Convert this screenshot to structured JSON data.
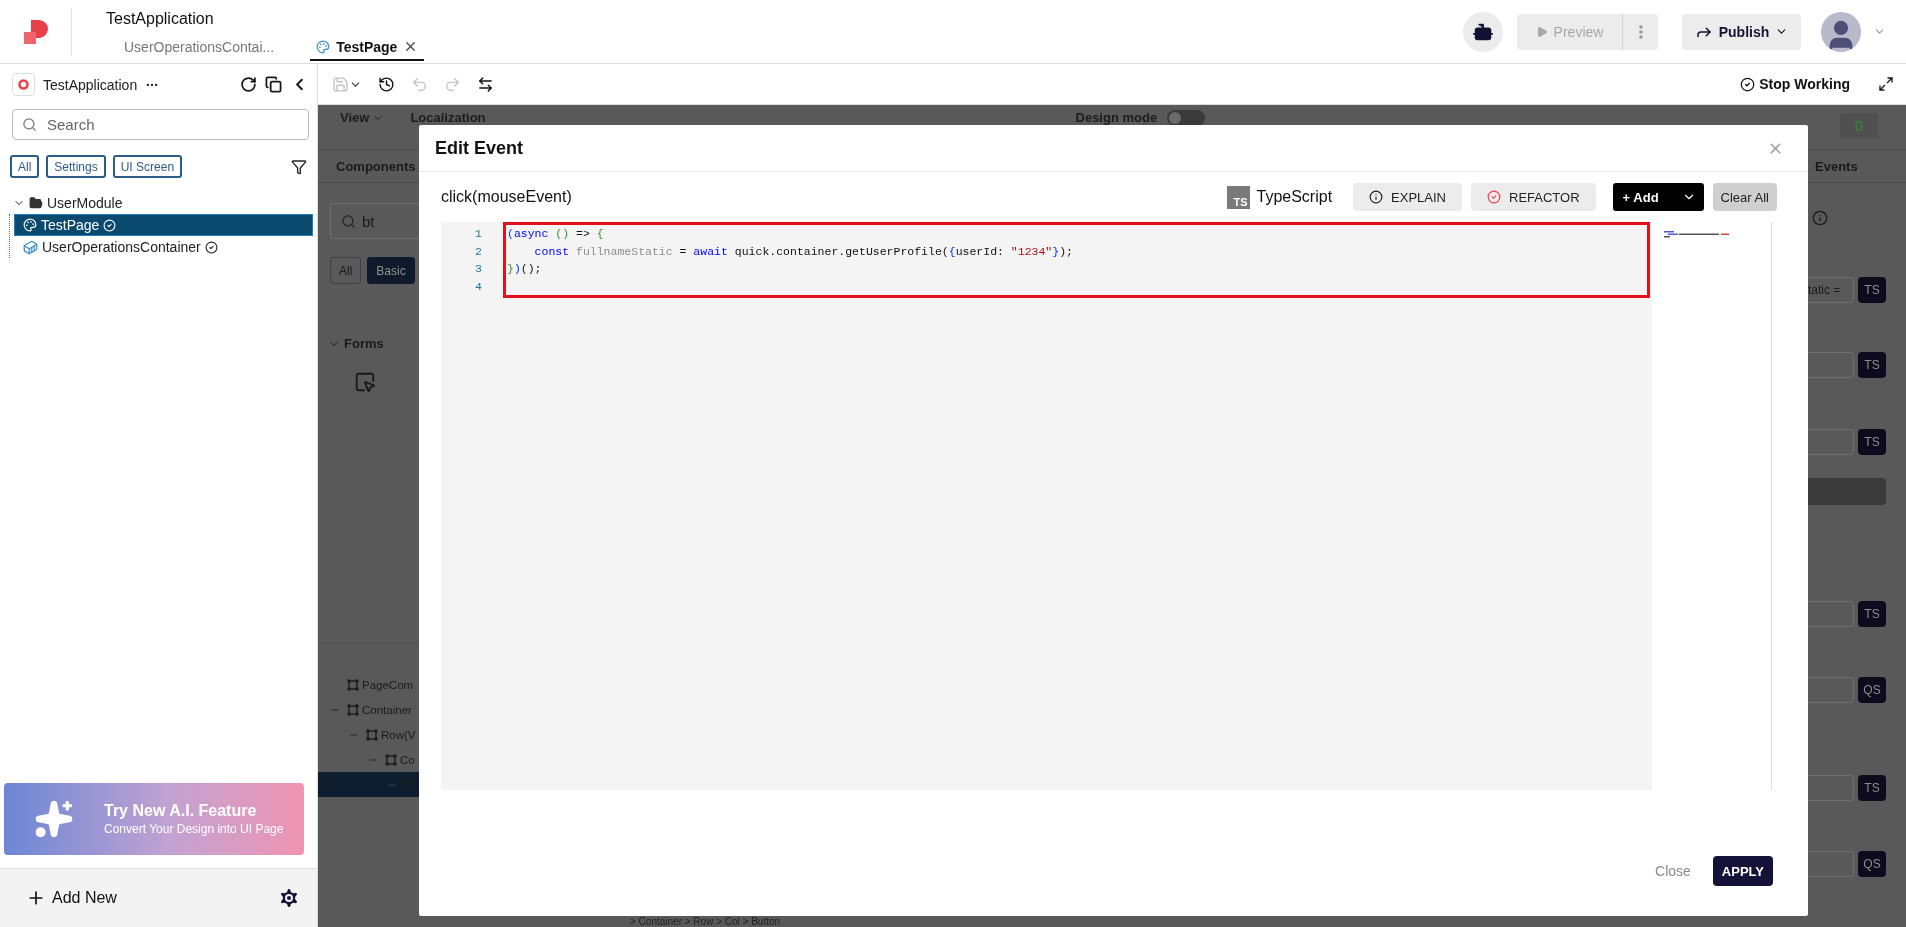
{
  "topbar": {
    "title": "TestApplication",
    "tabs": [
      {
        "label": "UserOperationsContai...",
        "selected": false
      },
      {
        "label": "TestPage",
        "selected": true
      }
    ],
    "preview": {
      "label": "Preview",
      "disabled": true
    },
    "publish": {
      "label": "Publish"
    }
  },
  "sidebar": {
    "app_name": "TestApplication",
    "search": {
      "placeholder": "Search"
    },
    "filters": [
      {
        "label": "All"
      },
      {
        "label": "Settings"
      },
      {
        "label": "UI Screen"
      }
    ],
    "tree": [
      {
        "label": "UserModule",
        "kind": "module",
        "selected": false,
        "expanded": true,
        "children": [
          {
            "label": "TestPage",
            "kind": "page",
            "selected": true
          },
          {
            "label": "UserOperationsContainer",
            "kind": "container",
            "selected": false
          }
        ]
      }
    ],
    "promo": {
      "title": "Try New A.I. Feature",
      "subtitle": "Convert Your Design into UI Page"
    },
    "add_new": "Add New"
  },
  "toolbar": {
    "tools": [
      {
        "kind": "save",
        "disabled": true
      },
      {
        "kind": "history",
        "disabled": false
      },
      {
        "kind": "undo",
        "disabled": true
      },
      {
        "kind": "redo",
        "disabled": true
      },
      {
        "kind": "swap",
        "disabled": false
      }
    ],
    "stop_working": "Stop Working"
  },
  "workspace": {
    "menu": "View",
    "localization": "Localization",
    "design_mode": {
      "label": "Design mode",
      "on": false
    },
    "counter": "0",
    "left_panel": {
      "tab": "Components",
      "search_value": "bt",
      "chips": [
        {
          "label": "All",
          "selected": false
        },
        {
          "label": "Basic",
          "selected": true
        }
      ],
      "section": "Forms",
      "tree": [
        {
          "label": "PageCom",
          "selected": false,
          "expanded": false
        },
        {
          "label": "Container",
          "selected": false,
          "expanded": true,
          "children": [
            {
              "label": "Row(V",
              "selected": false,
              "expanded": true,
              "children": [
                {
                  "label": "Co",
                  "selected": false,
                  "expanded": true,
                  "children": [
                    {
                      "selected": true,
                      "expanded": true
                    }
                  ]
                }
              ]
            }
          ]
        }
      ]
    },
    "right_panel": {
      "tab": "Events",
      "rows": [
        {
          "kind": "field",
          "value": "tatic =",
          "badge": "TS"
        },
        {
          "kind": "field",
          "badge": "TS"
        },
        {
          "kind": "field",
          "badge": "TS"
        },
        {
          "kind": "action"
        },
        {
          "kind": "field",
          "badge": "TS"
        },
        {
          "kind": "field",
          "badge": "QS"
        },
        {
          "kind": "field",
          "badge": "TS"
        },
        {
          "kind": "field",
          "badge": "QS"
        }
      ]
    },
    "breadcrumb": "> Container > Row > Col > Button"
  },
  "modal": {
    "title": "Edit Event",
    "event": "click(mouseEvent)",
    "language_badge": "TS",
    "language": "TypeScript",
    "actions": [
      {
        "kind": "explain",
        "label": "EXPLAIN"
      },
      {
        "kind": "refactor",
        "label": "REFACTOR"
      },
      {
        "kind": "add",
        "label": "+ Add"
      },
      {
        "kind": "clear",
        "label": "Clear All"
      }
    ],
    "code": [
      {
        "number": "1",
        "tokens": [
          {
            "text": "(",
            "kind": "bracket1"
          },
          {
            "text": "async ",
            "kind": "keyword"
          },
          {
            "text": "()",
            "kind": "bracket2"
          },
          {
            "text": " => ",
            "kind": "plain"
          },
          {
            "text": "{",
            "kind": "bracket2"
          }
        ]
      },
      {
        "number": "2",
        "tokens": [
          {
            "text": "    const ",
            "kind": "keyword"
          },
          {
            "text": "fullnameStatic",
            "kind": "variable"
          },
          {
            "text": " = ",
            "kind": "plain"
          },
          {
            "text": "await ",
            "kind": "keyword"
          },
          {
            "text": "quick.container.getUserProfile(",
            "kind": "plain"
          },
          {
            "text": "{",
            "kind": "bracket1"
          },
          {
            "text": "userId: ",
            "kind": "plain"
          },
          {
            "text": "\"1234\"",
            "kind": "string"
          },
          {
            "text": "}",
            "kind": "bracket1"
          },
          {
            "text": ");",
            "kind": "plain"
          }
        ]
      },
      {
        "number": "3",
        "tokens": [
          {
            "text": "}",
            "kind": "bracket2"
          },
          {
            "text": ")",
            "kind": "bracket1"
          },
          {
            "text": "();",
            "kind": "plain"
          }
        ]
      },
      {
        "number": "4"
      }
    ],
    "footer": {
      "close": "Close",
      "apply": "APPLY"
    }
  }
}
